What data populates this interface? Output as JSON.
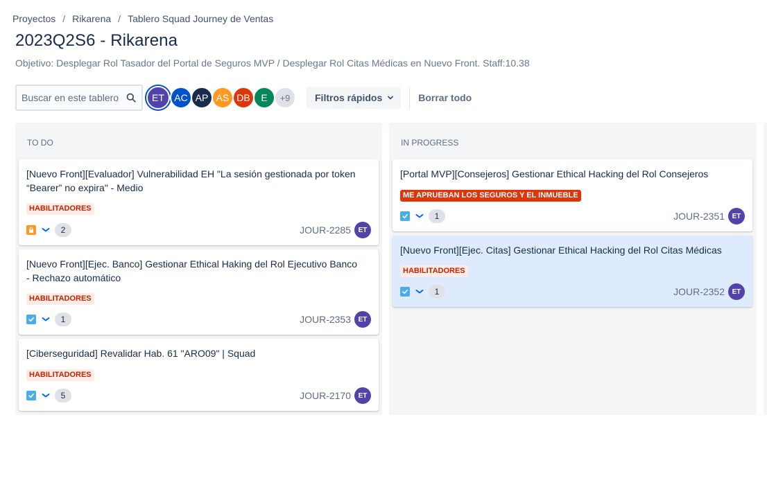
{
  "breadcrumb": {
    "items": [
      "Proyectos",
      "Rikarena",
      "Tablero Squad Journey de Ventas"
    ],
    "separator": "/"
  },
  "title": "2023Q2S6 - Rikarena",
  "objective": "Objetivo: Desplegar Rol Tasador del Portal de Seguros MVP / Desplegar Rol Citas Médicas en Nuevo Front. Staff:10.38",
  "toolbar": {
    "search_placeholder": "Buscar en este tablero",
    "avatars": [
      {
        "initials": "ET",
        "color": "#5243aa",
        "selected": true
      },
      {
        "initials": "AC",
        "color": "#0052cc",
        "selected": false
      },
      {
        "initials": "AP",
        "color": "#172b4d",
        "selected": false
      },
      {
        "initials": "AS",
        "color": "#ff991f",
        "selected": false
      },
      {
        "initials": "DB",
        "color": "#de350b",
        "selected": false
      },
      {
        "initials": "E",
        "color": "#00875a",
        "selected": false
      }
    ],
    "more_count": "+9",
    "quick_filters_label": "Filtros rápidos",
    "clear_all_label": "Borrar todo"
  },
  "columns": [
    {
      "name": "TO DO",
      "cards": [
        {
          "title": "[Nuevo Front][Evaluador] Vulnerabilidad EH \"La sesión gestionada por token “Bearer” no expira\" - Medio",
          "label": "HABILITADORES",
          "label_type": "hab",
          "type_icon": "lock-icon",
          "estimate": "2",
          "key": "JOUR-2285",
          "assignee": "ET"
        },
        {
          "title": "[Nuevo Front][Ejec. Banco] Gestionar Ethical Haking del Rol Ejecutivo Banco - Rechazo automático",
          "label": "HABILITADORES",
          "label_type": "hab",
          "type_icon": "task-icon",
          "estimate": "1",
          "key": "JOUR-2353",
          "assignee": "ET"
        },
        {
          "title": "[Ciberseguridad] Revalidar Hab. 61 \"ARO09\" | Squad",
          "label": "HABILITADORES",
          "label_type": "hab",
          "type_icon": "task-icon",
          "estimate": "5",
          "key": "JOUR-2170",
          "assignee": "ET"
        }
      ]
    },
    {
      "name": "IN PROGRESS",
      "cards": [
        {
          "title": "[Portal MVP][Consejeros] Gestionar Ethical Hacking del Rol Consejeros",
          "label": "ME APRUEBAN LOS SEGUROS Y EL INMUEBLE",
          "label_type": "epic",
          "type_icon": "task-icon",
          "estimate": "1",
          "key": "JOUR-2351",
          "assignee": "ET"
        },
        {
          "title": "[Nuevo Front][Ejec. Citas] Gestionar Ethical Hacking del Rol Citas Médicas",
          "label": "HABILITADORES",
          "label_type": "hab",
          "type_icon": "task-icon",
          "estimate": "1",
          "key": "JOUR-2352",
          "assignee": "ET",
          "selected": true
        }
      ]
    }
  ],
  "colors": {
    "accent": "#0052cc",
    "assignee_avatar": "#5243aa",
    "task_icon": "#4bade8",
    "lock_icon": "#ff991f",
    "priority_low": "#0065ff"
  }
}
